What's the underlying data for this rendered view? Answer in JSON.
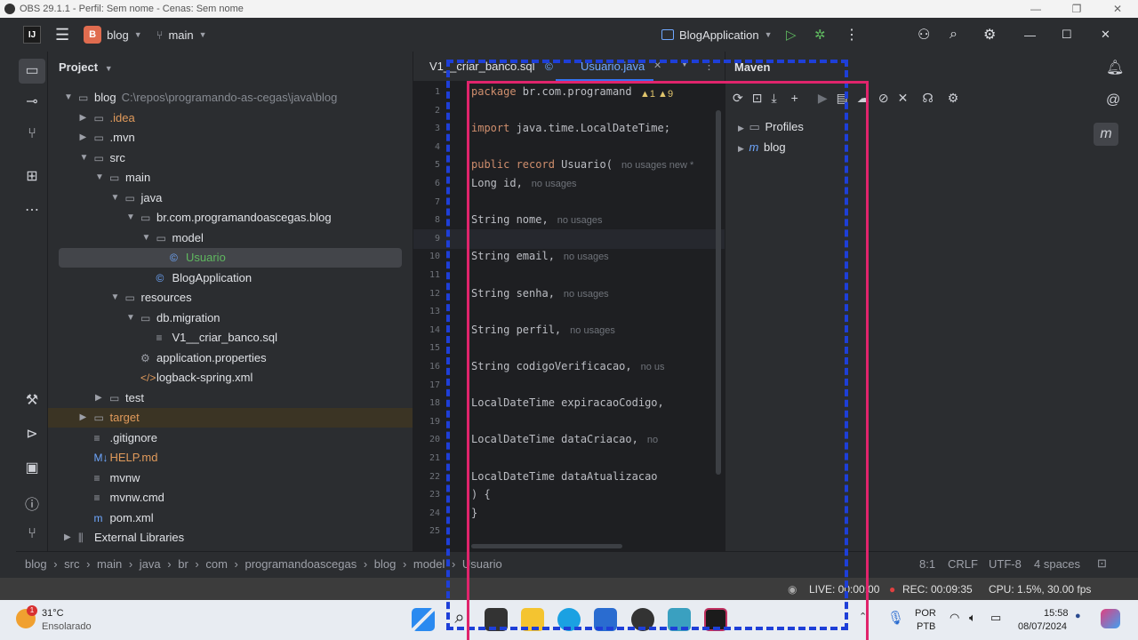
{
  "obs": {
    "title": "OBS 29.1.1 - Perfil: Sem nome - Cenas: Sem nome",
    "live": "LIVE: 00:00:00",
    "rec": "REC: 00:09:35",
    "cpu": "CPU: 1.5%, 30.00 fps"
  },
  "ide": {
    "project_name": "blog",
    "branch": "main",
    "run_config": "BlogApplication"
  },
  "project": {
    "header": "Project",
    "tree": [
      {
        "label": "blog",
        "extra": "C:\\repos\\programando-as-cegas\\java\\blog",
        "depth": 0,
        "expanded": true,
        "icon": "folder",
        "color": "#dfe1e5"
      },
      {
        "label": ".idea",
        "depth": 1,
        "expanded": false,
        "icon": "folder",
        "color": "#e09a5b"
      },
      {
        "label": ".mvn",
        "depth": 1,
        "expanded": false,
        "icon": "folder",
        "color": "#dfe1e5"
      },
      {
        "label": "src",
        "depth": 1,
        "expanded": true,
        "icon": "folder",
        "color": "#dfe1e5"
      },
      {
        "label": "main",
        "depth": 2,
        "expanded": true,
        "icon": "folder",
        "color": "#dfe1e5"
      },
      {
        "label": "java",
        "depth": 3,
        "expanded": true,
        "icon": "folder",
        "color": "#dfe1e5"
      },
      {
        "label": "br.com.programandoascegas.blog",
        "depth": 4,
        "expanded": true,
        "icon": "folder",
        "color": "#dfe1e5"
      },
      {
        "label": "model",
        "depth": 5,
        "expanded": true,
        "icon": "folder",
        "color": "#dfe1e5"
      },
      {
        "label": "Usuario",
        "depth": 6,
        "icon": "class",
        "color": "#5fb85f",
        "selected": true
      },
      {
        "label": "BlogApplication",
        "depth": 5,
        "icon": "class",
        "color": "#dfe1e5"
      },
      {
        "label": "resources",
        "depth": 3,
        "expanded": true,
        "icon": "folder",
        "color": "#dfe1e5"
      },
      {
        "label": "db.migration",
        "depth": 4,
        "expanded": true,
        "icon": "folder",
        "color": "#dfe1e5"
      },
      {
        "label": "V1__criar_banco.sql",
        "depth": 5,
        "icon": "file",
        "color": "#dfe1e5"
      },
      {
        "label": "application.properties",
        "depth": 4,
        "icon": "gear",
        "color": "#dfe1e5"
      },
      {
        "label": "logback-spring.xml",
        "depth": 4,
        "icon": "xml",
        "color": "#dfe1e5"
      },
      {
        "label": "test",
        "depth": 2,
        "expanded": false,
        "icon": "folder",
        "color": "#dfe1e5"
      },
      {
        "label": "target",
        "depth": 1,
        "expanded": false,
        "icon": "folder",
        "color": "#e09a5b",
        "highlight": true
      },
      {
        "label": ".gitignore",
        "depth": 1,
        "icon": "file",
        "color": "#dfe1e5"
      },
      {
        "label": "HELP.md",
        "depth": 1,
        "icon": "md",
        "color": "#e09a5b"
      },
      {
        "label": "mvnw",
        "depth": 1,
        "icon": "file",
        "color": "#dfe1e5"
      },
      {
        "label": "mvnw.cmd",
        "depth": 1,
        "icon": "file",
        "color": "#dfe1e5"
      },
      {
        "label": "pom.xml",
        "depth": 1,
        "icon": "maven",
        "color": "#dfe1e5"
      },
      {
        "label": "External Libraries",
        "depth": 0,
        "expanded": false,
        "icon": "lib",
        "color": "#dfe1e5"
      }
    ]
  },
  "editor": {
    "tabs": [
      "V1__criar_banco.sql",
      "Usuario.java"
    ],
    "inspections": "▲1 ▲9",
    "lines": [
      {
        "n": "1",
        "code": "package br.com.programand"
      },
      {
        "n": "2",
        "code": ""
      },
      {
        "n": "3",
        "code": "import java.time.LocalDateTime;"
      },
      {
        "n": "4",
        "code": ""
      },
      {
        "n": "5",
        "code": "public record Usuario(",
        "hint": "no usages   new *"
      },
      {
        "n": "6",
        "code": "        Long id,",
        "hint": "no usages"
      },
      {
        "n": "7",
        "code": ""
      },
      {
        "n": "8",
        "code": "        String nome,",
        "hint": "no usages"
      },
      {
        "n": "9",
        "code": ""
      },
      {
        "n": "10",
        "code": "        String email,",
        "hint": "no usages"
      },
      {
        "n": "11",
        "code": ""
      },
      {
        "n": "12",
        "code": "        String senha,",
        "hint": "no usages"
      },
      {
        "n": "13",
        "code": ""
      },
      {
        "n": "14",
        "code": "        String perfil,",
        "hint": "no usages"
      },
      {
        "n": "15",
        "code": ""
      },
      {
        "n": "16",
        "code": "        String codigoVerificacao,",
        "hint": "no us"
      },
      {
        "n": "17",
        "code": ""
      },
      {
        "n": "18",
        "code": "        LocalDateTime expiracaoCodigo,"
      },
      {
        "n": "19",
        "code": ""
      },
      {
        "n": "20",
        "code": "        LocalDateTime dataCriacao,",
        "hint": "no"
      },
      {
        "n": "21",
        "code": ""
      },
      {
        "n": "22",
        "code": "        LocalDateTime dataAtualizacao"
      },
      {
        "n": "23",
        "code": ") {"
      },
      {
        "n": "24",
        "code": "}"
      },
      {
        "n": "25",
        "code": ""
      }
    ]
  },
  "maven": {
    "title": "Maven",
    "items": [
      "Profiles",
      "blog"
    ]
  },
  "statusbar": {
    "breadcrumb": [
      "blog",
      "src",
      "main",
      "java",
      "br",
      "com",
      "programandoascegas",
      "blog",
      "model",
      "Usuario"
    ],
    "position": "8:1",
    "line_sep": "CRLF",
    "encoding": "UTF-8",
    "indent": "4 spaces"
  },
  "taskbar": {
    "temp": "31°C",
    "weather": "Ensolarado",
    "lang1": "POR",
    "lang2": "PTB",
    "time": "15:58",
    "date": "08/07/2024"
  }
}
